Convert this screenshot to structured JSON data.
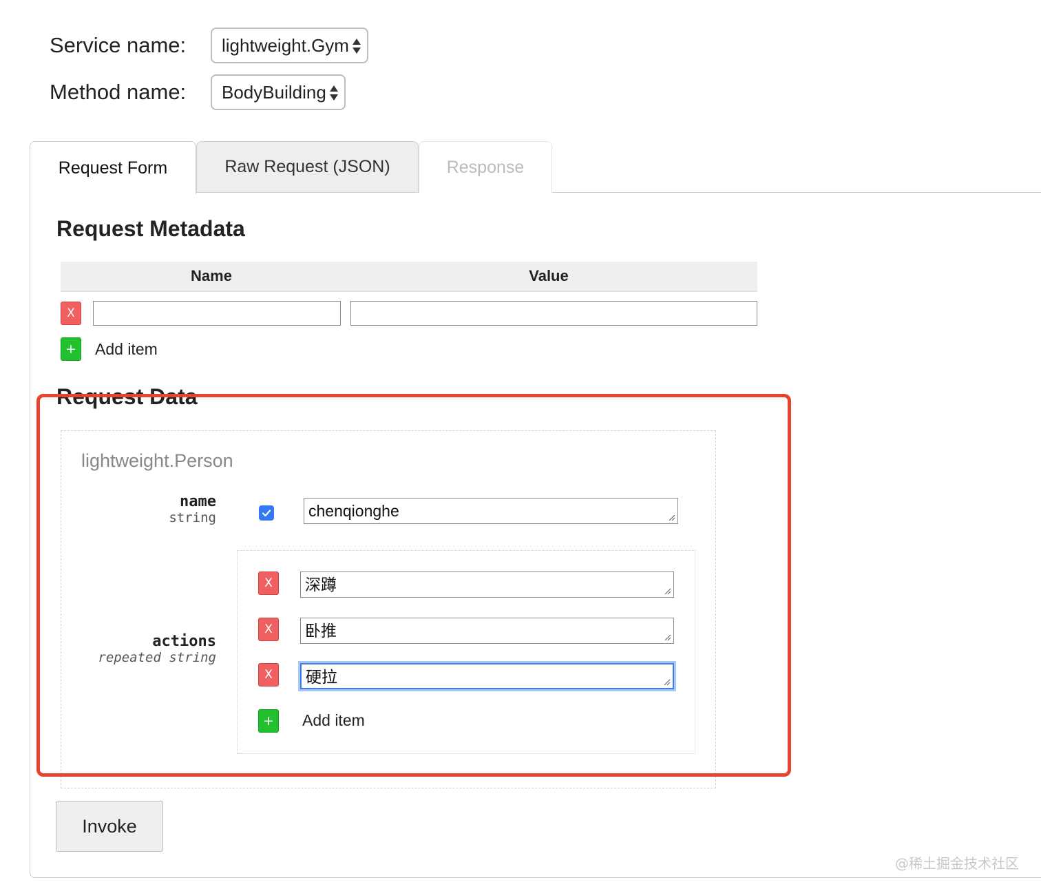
{
  "service": {
    "label": "Service name:",
    "value": "lightweight.Gym"
  },
  "method": {
    "label": "Method name:",
    "value": "BodyBuilding"
  },
  "tabs": [
    {
      "label": "Request Form",
      "state": "active"
    },
    {
      "label": "Raw Request (JSON)",
      "state": "inactive"
    },
    {
      "label": "Response",
      "state": "disabled"
    }
  ],
  "metadata": {
    "title": "Request Metadata",
    "columns": [
      "Name",
      "Value"
    ],
    "rows": [
      {
        "name": "",
        "value": ""
      }
    ],
    "remove_label": "X",
    "add_symbol": "+",
    "add_label": "Add item"
  },
  "request_data": {
    "title": "Request Data",
    "message_type": "lightweight.Person",
    "fields": {
      "name": {
        "name": "name",
        "type": "string",
        "checked": true,
        "value": "chenqionghe"
      },
      "actions": {
        "name": "actions",
        "type": "repeated string",
        "items": [
          "深蹲",
          "卧推",
          "硬拉"
        ],
        "remove_label": "X",
        "add_symbol": "+",
        "add_label": "Add item"
      }
    }
  },
  "invoke_label": "Invoke",
  "watermark": "@稀土掘金技术社区",
  "colors": {
    "highlight": "#e8432f",
    "remove": "#f06060",
    "add": "#22c02e",
    "checkbox": "#3478f6",
    "focus": "#3b7de8"
  }
}
